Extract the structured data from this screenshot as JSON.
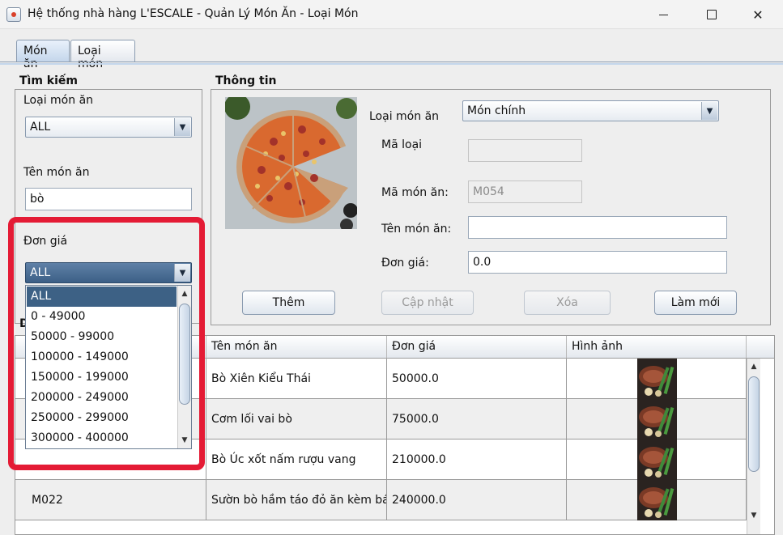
{
  "window": {
    "title": "Hệ thống nhà hàng L'ESCALE - Quản Lý Món Ăn - Loại Món",
    "min_glyph": "",
    "close_glyph": "✕"
  },
  "tabs": [
    {
      "label": "Món ăn"
    },
    {
      "label": "Loại món"
    }
  ],
  "search": {
    "title": "Tìm kiếm",
    "category_label": "Loại món ăn",
    "category_value": "ALL",
    "name_label": "Tên món ăn",
    "name_value": "bò",
    "price_label": "Đơn giá",
    "price_value": "ALL",
    "price_options": [
      "ALL",
      "0 - 49000",
      "50000 - 99000",
      "100000 - 149000",
      "150000 - 199000",
      "200000 - 249000",
      "250000 - 299000",
      "300000 - 400000"
    ]
  },
  "info": {
    "title": "Thông tin",
    "category_label": "Loại món ăn",
    "category_value": "Món chính",
    "type_code_label": "Mã loại",
    "type_code_value": "",
    "dish_code_label": "Mã món ăn:",
    "dish_code_value": "M054",
    "dish_name_label": "Tên món ăn:",
    "dish_name_value": "",
    "price_label": "Đơn giá:",
    "price_value": "0.0",
    "buttons": {
      "add": "Thêm",
      "update": "Cập nhật",
      "delete": "Xóa",
      "refresh": "Làm mới"
    }
  },
  "table": {
    "partial_title": "D",
    "columns": [
      "Tên món ăn",
      "Đơn giá",
      "Hình ảnh"
    ],
    "rows": [
      {
        "code": "",
        "name": "Bò Xiên Kiểu Thái",
        "price": "50000.0"
      },
      {
        "code": "",
        "name": "Cơm lối vai bò",
        "price": "75000.0"
      },
      {
        "code": "",
        "name": "Bò Úc xốt nấm rượu vang",
        "price": "210000.0"
      },
      {
        "code": "M022",
        "name": "Sườn bò hầm táo đỏ ăn kèm bá...",
        "price": "240000.0"
      }
    ]
  },
  "icons": {
    "combo_arrow": "▼",
    "scroll_up": "▲",
    "scroll_down": "▼"
  },
  "colors": {
    "highlight": "#e41b35",
    "selection": "#3d6185"
  }
}
